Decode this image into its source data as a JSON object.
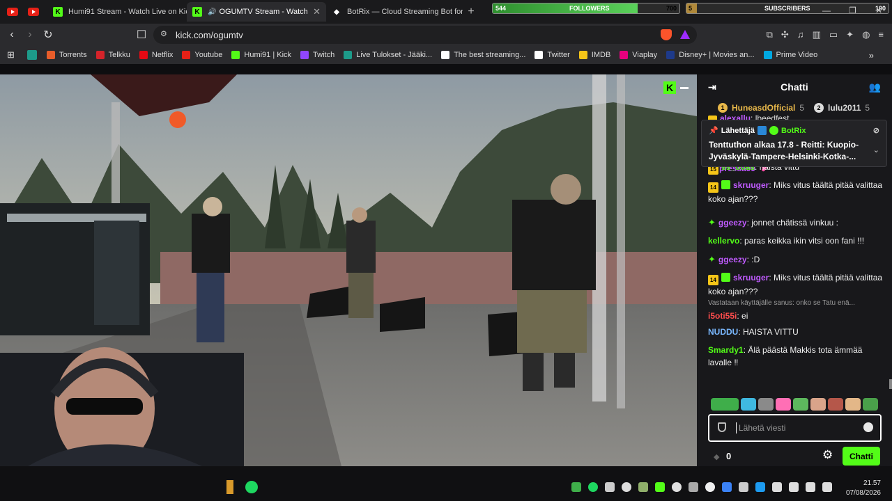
{
  "tabs": [
    {
      "label": "Humi91 Stream - Watch Live on Kick",
      "active": false
    },
    {
      "label": "OGUMTV Stream - Watch Live",
      "active": true
    },
    {
      "label": "BotRix — Cloud Streaming Bot for Tw",
      "active": false
    }
  ],
  "overlay": {
    "followers_label": "FOLLOWERS",
    "followers_current": "544",
    "followers_goal": "700",
    "followers_progress": 0.777,
    "subscribers_label": "SUBSCRIBERS",
    "subscribers_current": "5",
    "subscribers_goal": "100",
    "subscribers_progress": 0.05
  },
  "address": {
    "url": "kick.com/ogumtv"
  },
  "bookmarks": [
    {
      "label": "Torrents",
      "icon": "torrent-icon",
      "color": "#e85d2a"
    },
    {
      "label": "Telkku",
      "icon": "telkku-icon",
      "color": "#d4232a"
    },
    {
      "label": "Netflix",
      "icon": "netflix-icon",
      "color": "#e50914"
    },
    {
      "label": "Youtube",
      "icon": "youtube-icon",
      "color": "#e62117"
    },
    {
      "label": "Humi91 | Kick",
      "icon": "kick-icon",
      "color": "#53fc18"
    },
    {
      "label": "Twitch",
      "icon": "twitch-icon",
      "color": "#9146ff"
    },
    {
      "label": "Live Tulokset - Jääki...",
      "icon": "live-icon",
      "color": "#1d9b8a"
    },
    {
      "label": "The best streaming...",
      "icon": "streaming-icon",
      "color": "#ffffff"
    },
    {
      "label": "Twitter",
      "icon": "x-icon",
      "color": "#ffffff"
    },
    {
      "label": "IMDB",
      "icon": "imdb-icon",
      "color": "#f5c518"
    },
    {
      "label": "Viaplay",
      "icon": "viaplay-icon",
      "color": "#e6007e"
    },
    {
      "label": "Disney+ | Movies an...",
      "icon": "disney-icon",
      "color": "#1e3a8a"
    },
    {
      "label": "Prime Video",
      "icon": "prime-icon",
      "color": "#00a8e1"
    }
  ],
  "chat": {
    "title": "Chatti",
    "leaders": [
      {
        "name": "HuneasdOfficial",
        "count": "5",
        "rank": "1",
        "color": "#e8b84a"
      },
      {
        "name": "lulu2011",
        "count": "5",
        "rank": "2",
        "color": "#dcdcdc"
      }
    ],
    "peek_line": {
      "user": "alexallu",
      "text": "lbeedfest"
    },
    "pinned": {
      "label": "Lähettäjä",
      "author": "BotRix",
      "text": "Tenttuthon alkaa 17.8 - Reitti: Kuopio-Jyväskylä-Tampere-Helsinki-Kotka-..."
    },
    "under_pin": {
      "user": "pressa99"
    },
    "messages": [
      {
        "user": "ss_ooas",
        "text": "haista vittu",
        "badge": "15",
        "color": "#53fc18"
      },
      {
        "user": "skruuger",
        "text": "Miks vitus täältä pitää valittaa koko ajan???",
        "badge": "14",
        "color": "#c05bff"
      },
      {
        "user": "ggeezy",
        "text": "jonnet chätissä vinkuu :",
        "badge": "",
        "color": "#c05bff"
      },
      {
        "user": "kellervo",
        "text": "paras keikka ikin vitsi oon fani !!!",
        "badge": "",
        "color": "#53fc18"
      },
      {
        "user": "ggeezy",
        "text": ":D",
        "badge": "",
        "color": "#c05bff"
      },
      {
        "user": "skruuger",
        "text": "Miks vitus täältä pitää valittaa koko ajan???",
        "badge": "14",
        "color": "#c05bff"
      },
      {
        "reply_to": "Vastataan käyttäjälle sanus: onko se Tatu enä...",
        "user": "i5oti55i",
        "text": "ei",
        "color": "#ff4d4d"
      },
      {
        "user": "NUDDU",
        "text": "HAISTA VITTU",
        "badge": "",
        "color": "#7ab8ff"
      },
      {
        "user": "Smardy1",
        "text": "Älä päästä Makkis tota ämmää lavalle ‼",
        "badge": "",
        "color": "#53fc18"
      }
    ],
    "input_placeholder": "Lähetä viesti",
    "points": "0",
    "send_label": "Chatti"
  },
  "taskbar": {
    "time": "21.57",
    "date": "07/08/2026"
  }
}
